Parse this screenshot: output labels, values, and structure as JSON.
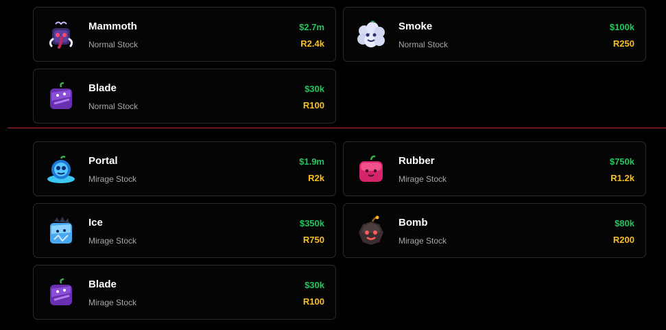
{
  "normal_stock": [
    {
      "name": "Mammoth",
      "stock": "Normal Stock",
      "price": "$2.7m",
      "robux": "R2.4k",
      "icon": "mammoth-fruit-icon"
    },
    {
      "name": "Smoke",
      "stock": "Normal Stock",
      "price": "$100k",
      "robux": "R250",
      "icon": "smoke-fruit-icon"
    },
    {
      "name": "Blade",
      "stock": "Normal Stock",
      "price": "$30k",
      "robux": "R100",
      "icon": "blade-fruit-icon"
    }
  ],
  "mirage_stock": [
    {
      "name": "Portal",
      "stock": "Mirage Stock",
      "price": "$1.9m",
      "robux": "R2k",
      "icon": "portal-fruit-icon"
    },
    {
      "name": "Rubber",
      "stock": "Mirage Stock",
      "price": "$750k",
      "robux": "R1.2k",
      "icon": "rubber-fruit-icon"
    },
    {
      "name": "Ice",
      "stock": "Mirage Stock",
      "price": "$350k",
      "robux": "R750",
      "icon": "ice-fruit-icon"
    },
    {
      "name": "Bomb",
      "stock": "Mirage Stock",
      "price": "$80k",
      "robux": "R200",
      "icon": "bomb-fruit-icon"
    },
    {
      "name": "Blade",
      "stock": "Mirage Stock",
      "price": "$30k",
      "robux": "R100",
      "icon": "blade-fruit-icon"
    }
  ],
  "colors": {
    "background": "#000000",
    "card_border": "#2b2b2b",
    "name": "#ffffff",
    "stock_label": "#a7a9ad",
    "price": "#22c55e",
    "robux": "#fbbf24",
    "divider": "#c0262d"
  }
}
